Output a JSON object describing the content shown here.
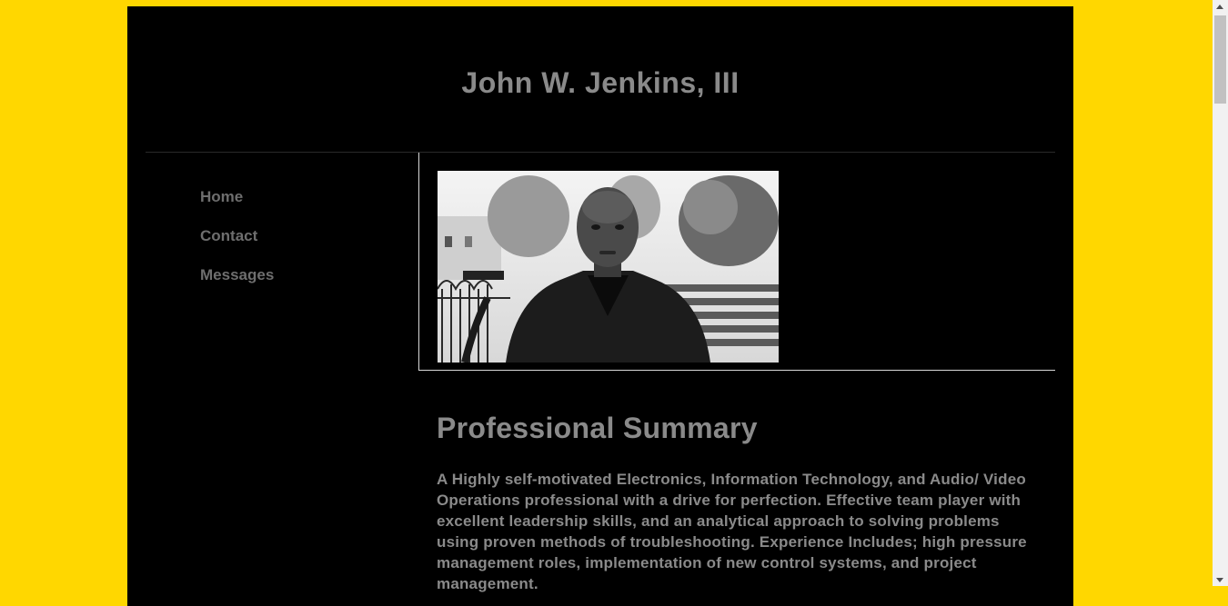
{
  "site": {
    "title": "John W. Jenkins, III"
  },
  "nav": {
    "items": [
      {
        "label": "Home"
      },
      {
        "label": "Contact"
      },
      {
        "label": "Messages"
      }
    ]
  },
  "main": {
    "heading": "Professional Summary",
    "summary": "A Highly self-motivated Electronics, Information Technology, and Audio/ Video Operations professional with a drive for perfection. Effective team player with excellent leadership skills, and an analytical approach to solving problems using proven methods of troubleshooting. Experience Includes; high pressure management roles, implementation of new control systems, and project management."
  },
  "colors": {
    "background": "#FFD700",
    "page": "#000000",
    "text": "#8a8a8a",
    "nav_text": "#6e6e6e"
  }
}
